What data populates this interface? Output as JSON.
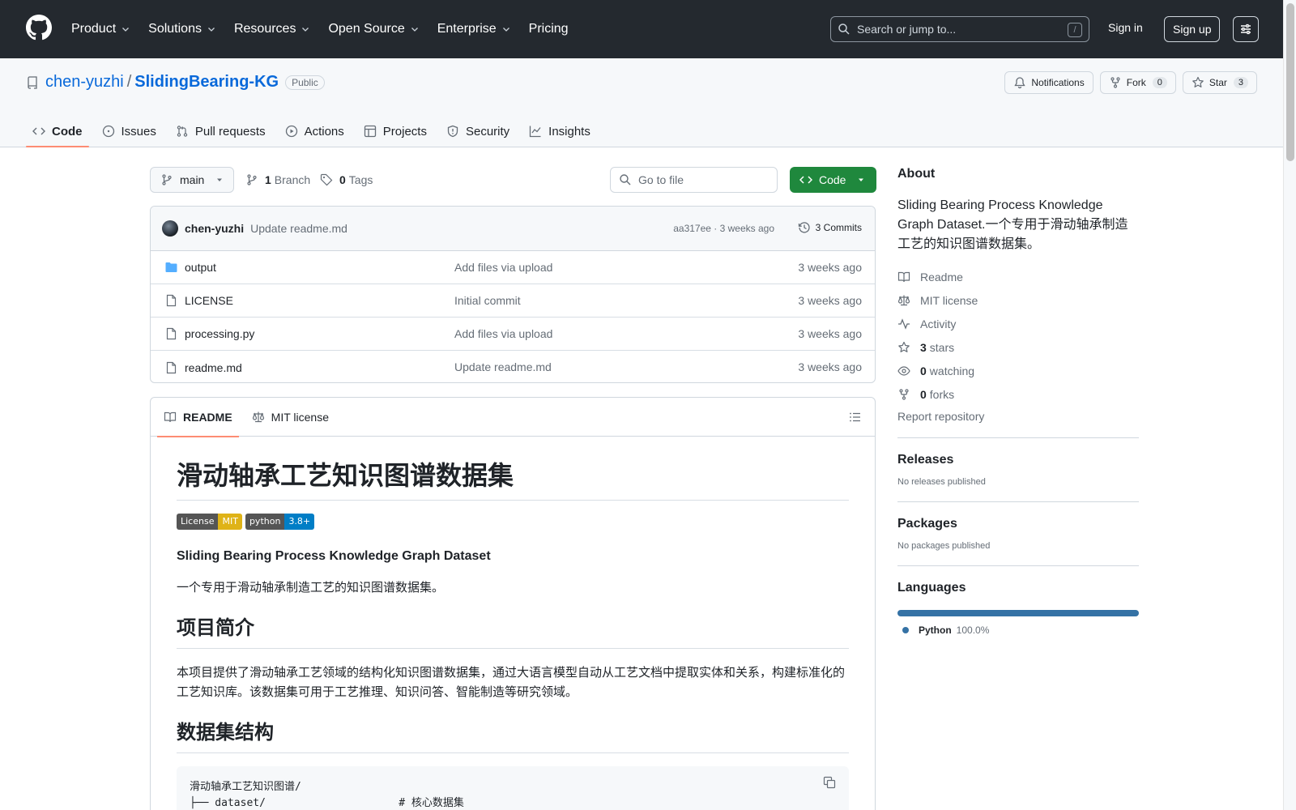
{
  "header": {
    "nav": [
      {
        "label": "Product"
      },
      {
        "label": "Solutions"
      },
      {
        "label": "Resources"
      },
      {
        "label": "Open Source"
      },
      {
        "label": "Enterprise"
      },
      {
        "label": "Pricing"
      }
    ],
    "search_placeholder": "Search or jump to...",
    "search_shortcut": "/",
    "signin_label": "Sign in",
    "signup_label": "Sign up"
  },
  "repo": {
    "owner": "chen-yuzhi",
    "separator": "/",
    "name": "SlidingBearing-KG",
    "visibility": "Public",
    "notifications_label": "Notifications",
    "fork_label": "Fork",
    "fork_count": "0",
    "star_label": "Star",
    "star_count": "3",
    "tabs": [
      {
        "label": "Code",
        "icon": "code-icon",
        "active": true
      },
      {
        "label": "Issues",
        "icon": "issue-icon"
      },
      {
        "label": "Pull requests",
        "icon": "pull-request-icon"
      },
      {
        "label": "Actions",
        "icon": "play-icon"
      },
      {
        "label": "Projects",
        "icon": "table-icon"
      },
      {
        "label": "Security",
        "icon": "shield-icon"
      },
      {
        "label": "Insights",
        "icon": "graph-icon"
      }
    ]
  },
  "toolbar": {
    "branch": "main",
    "branch_count": "1",
    "branch_label": "Branch",
    "tag_count": "0",
    "tag_label": "Tags",
    "goto_placeholder": "Go to file",
    "code_label": "Code"
  },
  "commit": {
    "author": "chen-yuzhi",
    "message": "Update readme.md",
    "meta": "aa317ee · 3 weeks ago",
    "count": "3 Commits"
  },
  "files": [
    {
      "name": "output",
      "type": "folder",
      "commit": "Add files via upload",
      "age": "3 weeks ago"
    },
    {
      "name": "LICENSE",
      "type": "file",
      "commit": "Initial commit",
      "age": "3 weeks ago"
    },
    {
      "name": "processing.py",
      "type": "file",
      "commit": "Add files via upload",
      "age": "3 weeks ago"
    },
    {
      "name": "readme.md",
      "type": "file",
      "commit": "Update readme.md",
      "age": "3 weeks ago"
    }
  ],
  "readme": {
    "tab_readme": "README",
    "tab_license": "MIT license",
    "h1": "滑动轴承工艺知识图谱数据集",
    "badge_license_l": "License",
    "badge_license_r": "MIT",
    "badge_python_l": "python",
    "badge_python_r": "3.8+",
    "subtitle": "Sliding Bearing Process Knowledge Graph Dataset",
    "intro": "一个专用于滑动轴承制造工艺的知识图谱数据集。",
    "h2_intro": "项目简介",
    "intro_body": "本项目提供了滑动轴承工艺领域的结构化知识图谱数据集，通过大语言模型自动从工艺文档中提取实体和关系，构建标准化的工艺知识库。该数据集可用于工艺推理、知识问答、智能制造等研究领域。",
    "h2_structure": "数据集结构",
    "code_line1": "滑动轴承工艺知识图谱/",
    "code_line2": "├── dataset/                     # 核心数据集"
  },
  "about": {
    "title": "About",
    "description": "Sliding Bearing Process Knowledge Graph Dataset.一个专用于滑动轴承制造工艺的知识图谱数据集。",
    "readme": "Readme",
    "license": "MIT license",
    "activity": "Activity",
    "stars_count": "3",
    "stars_label": "stars",
    "watching_count": "0",
    "watching_label": "watching",
    "forks_count": "0",
    "forks_label": "forks",
    "report": "Report repository"
  },
  "releases": {
    "title": "Releases",
    "empty": "No releases published"
  },
  "packages": {
    "title": "Packages",
    "empty": "No packages published"
  },
  "languages": {
    "title": "Languages",
    "items": [
      {
        "name": "Python",
        "percent": "100.0%",
        "share": 1.0,
        "color": "#3572A5"
      }
    ]
  }
}
